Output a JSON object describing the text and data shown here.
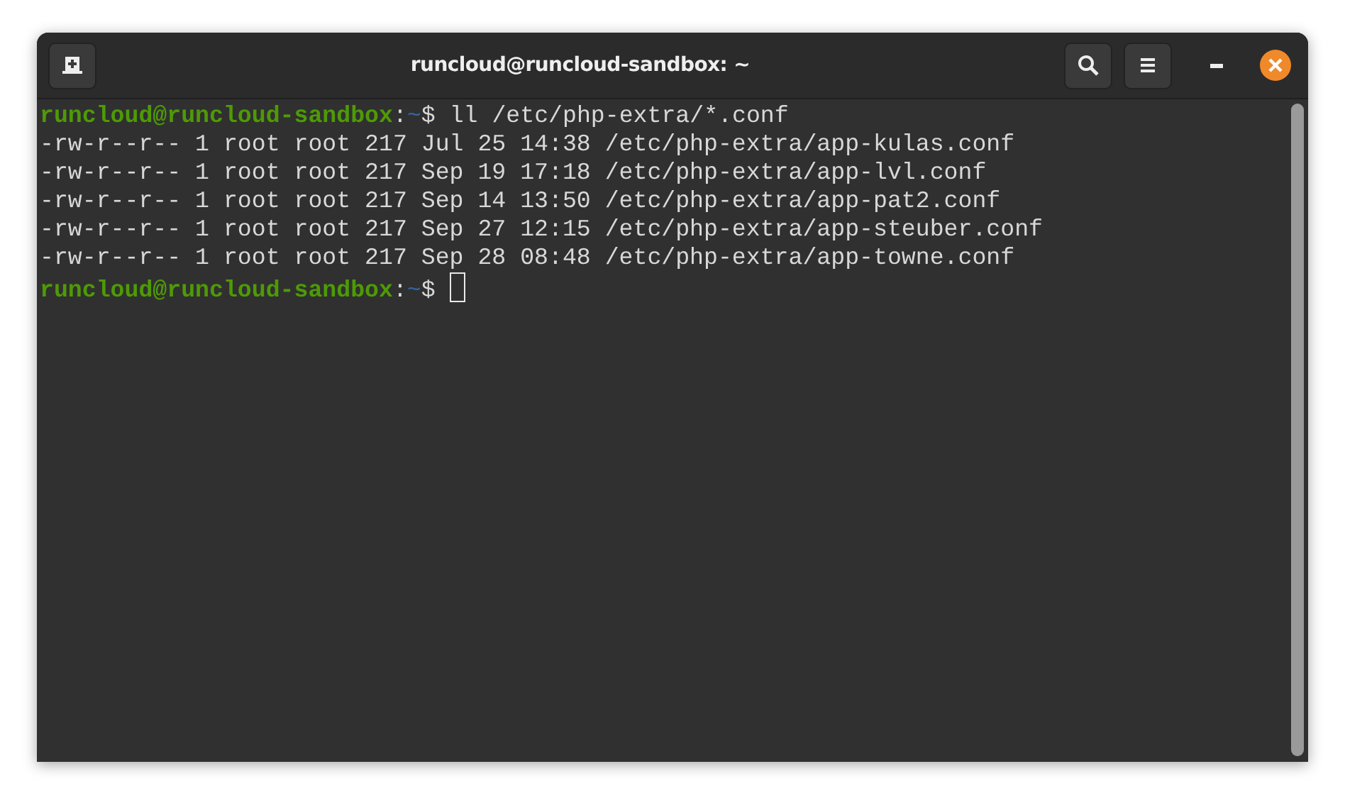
{
  "window": {
    "title": "runcloud@runcloud-sandbox: ~"
  },
  "terminal": {
    "lines": [
      {
        "kind": "prompt",
        "user_host": "runcloud@runcloud-sandbox",
        "separator": ":",
        "path": "~",
        "symbol": "$",
        "command": "ll /etc/php-extra/*.conf",
        "cursor": false
      },
      {
        "kind": "output",
        "text": "-rw-r--r-- 1 root root 217 Jul 25 14:38 /etc/php-extra/app-kulas.conf"
      },
      {
        "kind": "output",
        "text": "-rw-r--r-- 1 root root 217 Sep 19 17:18 /etc/php-extra/app-lvl.conf"
      },
      {
        "kind": "output",
        "text": "-rw-r--r-- 1 root root 217 Sep 14 13:50 /etc/php-extra/app-pat2.conf"
      },
      {
        "kind": "output",
        "text": "-rw-r--r-- 1 root root 217 Sep 27 12:15 /etc/php-extra/app-steuber.conf"
      },
      {
        "kind": "output",
        "text": "-rw-r--r-- 1 root root 217 Sep 28 08:48 /etc/php-extra/app-towne.conf"
      },
      {
        "kind": "prompt",
        "user_host": "runcloud@runcloud-sandbox",
        "separator": ":",
        "path": "~",
        "symbol": "$",
        "cursor": true
      }
    ]
  }
}
